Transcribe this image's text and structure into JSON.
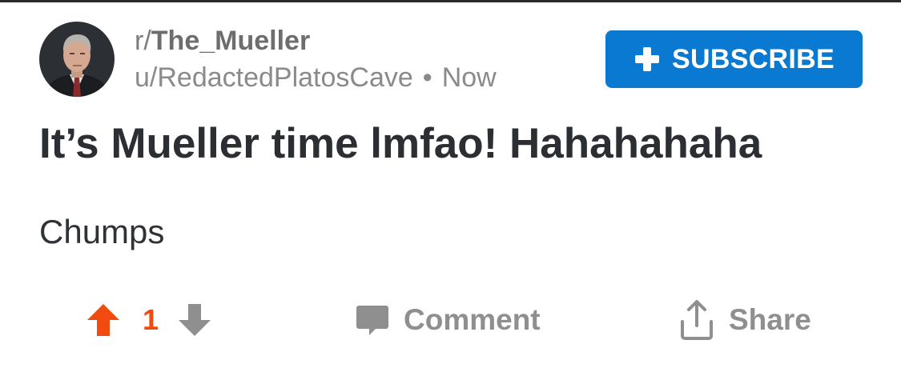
{
  "post": {
    "subreddit_prefix": "r/",
    "subreddit_name": "The_Mueller",
    "author": "u/RedactedPlatosCave",
    "separator": "•",
    "time": "Now",
    "title": "It’s Mueller time lmfao! Hahahahaha",
    "body": "Chumps"
  },
  "header": {
    "subscribe_label": "SUBSCRIBE"
  },
  "actions": {
    "vote_count": "1",
    "comment_label": "Comment",
    "share_label": "Share"
  },
  "colors": {
    "accent_blue": "#0a79d2",
    "upvote_orange": "#f24b10",
    "action_gray": "#8f8f8f",
    "title_text": "#2b2e33"
  },
  "icons": {
    "upvote": "upvote-arrow-icon",
    "downvote": "downvote-arrow-icon",
    "comment": "comment-bubble-icon",
    "share": "share-upload-icon",
    "plus": "plus-icon"
  }
}
